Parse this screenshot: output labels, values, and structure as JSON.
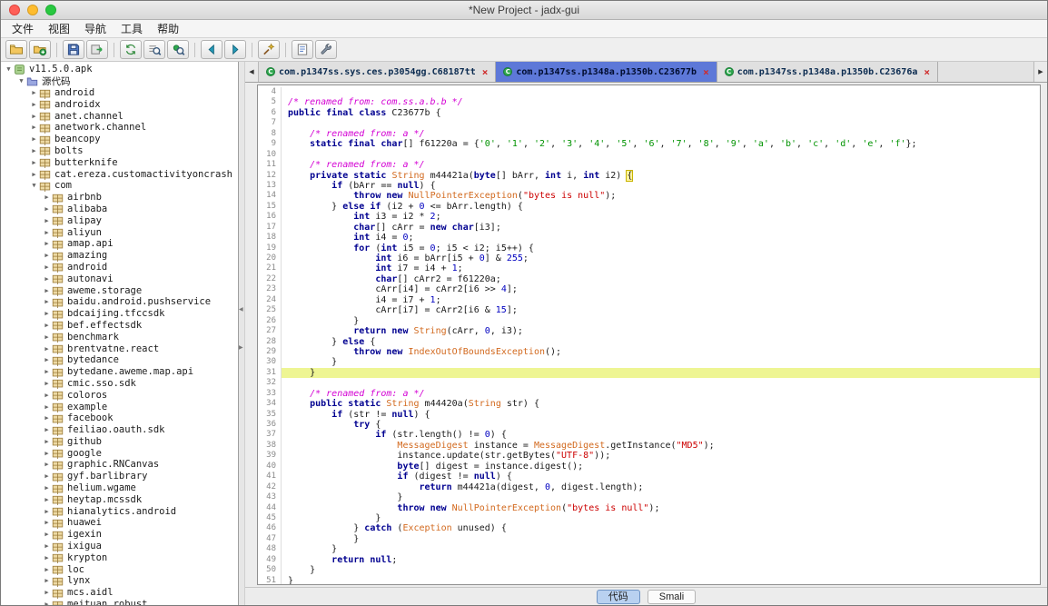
{
  "window": {
    "title": "*New Project - jadx-gui"
  },
  "menu": {
    "items": [
      {
        "name": "file",
        "label": "文件"
      },
      {
        "name": "view",
        "label": "视图"
      },
      {
        "name": "navigation",
        "label": "导航"
      },
      {
        "name": "tools",
        "label": "工具"
      },
      {
        "name": "help",
        "label": "帮助"
      }
    ]
  },
  "toolbar": {
    "groups": [
      [
        "open-project",
        "add-files"
      ],
      [
        "save-all",
        "export-code"
      ],
      [
        "sync-editor",
        "text-search",
        "class-search"
      ],
      [
        "nav-back",
        "nav-forward"
      ],
      [
        "deobfuscation"
      ],
      [
        "log-viewer",
        "preferences"
      ]
    ]
  },
  "sidebar": {
    "root_label": "v11.5.0.apk",
    "source_label": "源代码",
    "top_packages": [
      "android",
      "androidx",
      "anet.channel",
      "anetwork.channel",
      "beancopy",
      "bolts",
      "butterknife",
      "cat.ereza.customactivityoncrash"
    ],
    "com_label": "com",
    "com_children": [
      "airbnb",
      "alibaba",
      "alipay",
      "aliyun",
      "amap.api",
      "amazing",
      "android",
      "autonavi",
      "aweme.storage",
      "baidu.android.pushservice",
      "bdcaijing.tfccsdk",
      "bef.effectsdk",
      "benchmark",
      "brentvatne.react",
      "bytedance",
      "bytedane.aweme.map.api",
      "cmic.sso.sdk",
      "coloros",
      "example",
      "facebook",
      "feiliao.oauth.sdk",
      "github",
      "google",
      "graphic.RNCanvas",
      "gyf.barlibrary",
      "helium.wgame",
      "heytap.mcssdk",
      "hianalytics.android",
      "huawei",
      "igexin",
      "ixigua",
      "krypton",
      "loc",
      "lynx",
      "mcs.aidl",
      "meituan.robust"
    ]
  },
  "tabs": {
    "items": [
      {
        "label": "com.p1347ss.sys.ces.p3054gg.C68187tt",
        "active": false
      },
      {
        "label": "com.p1347ss.p1348a.p1350b.C23677b",
        "active": true
      },
      {
        "label": "com.p1347ss.p1348a.p1350b.C23676a",
        "active": false
      }
    ]
  },
  "editor": {
    "first_line": 4,
    "highlight_line": 31,
    "bracket_line": 12,
    "lines": [
      "",
      "/* renamed from: com.ss.a.b.b */",
      "public final class C23677b {",
      "",
      "    /* renamed from: a */",
      "    static final char[] f61220a = {'0', '1', '2', '3', '4', '5', '6', '7', '8', '9', 'a', 'b', 'c', 'd', 'e', 'f'};",
      "",
      "    /* renamed from: a */",
      "    private static String m44421a(byte[] bArr, int i, int i2) {",
      "        if (bArr == null) {",
      "            throw new NullPointerException(\"bytes is null\");",
      "        } else if (i2 + 0 <= bArr.length) {",
      "            int i3 = i2 * 2;",
      "            char[] cArr = new char[i3];",
      "            int i4 = 0;",
      "            for (int i5 = 0; i5 < i2; i5++) {",
      "                int i6 = bArr[i5 + 0] & 255;",
      "                int i7 = i4 + 1;",
      "                char[] cArr2 = f61220a;",
      "                cArr[i4] = cArr2[i6 >> 4];",
      "                i4 = i7 + 1;",
      "                cArr[i7] = cArr2[i6 & 15];",
      "            }",
      "            return new String(cArr, 0, i3);",
      "        } else {",
      "            throw new IndexOutOfBoundsException();",
      "        }",
      "    }",
      "",
      "    /* renamed from: a */",
      "    public static String m44420a(String str) {",
      "        if (str != null) {",
      "            try {",
      "                if (str.length() != 0) {",
      "                    MessageDigest instance = MessageDigest.getInstance(\"MD5\");",
      "                    instance.update(str.getBytes(\"UTF-8\"));",
      "                    byte[] digest = instance.digest();",
      "                    if (digest != null) {",
      "                        return m44421a(digest, 0, digest.length);",
      "                    }",
      "                    throw new NullPointerException(\"bytes is null\");",
      "                }",
      "            } catch (Exception unused) {",
      "            }",
      "        }",
      "        return null;",
      "    }",
      "}"
    ]
  },
  "bottom_bar": {
    "code_label": "代码",
    "smali_label": "Smali"
  },
  "colors": {
    "active_tab_bg": "#5d78d8",
    "line_highlight": "#eef593",
    "selected_toggle_bg": "#b9d1f0",
    "accent_blue": "#4f79c4"
  }
}
